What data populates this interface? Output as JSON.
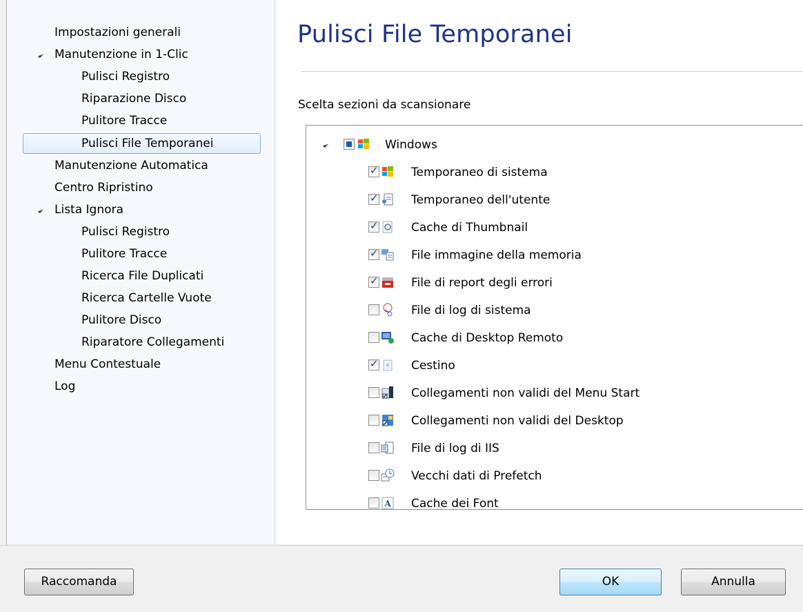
{
  "sidebar": {
    "items": [
      {
        "label": "Impostazioni generali"
      },
      {
        "label": "Manutenzione in 1-Clic"
      },
      {
        "label": "Pulisci Registro"
      },
      {
        "label": "Riparazione Disco"
      },
      {
        "label": "Pulitore Tracce"
      },
      {
        "label": "Pulisci File Temporanei"
      },
      {
        "label": "Manutenzione Automatica"
      },
      {
        "label": "Centro Ripristino"
      },
      {
        "label": "Lista Ignora"
      },
      {
        "label": "Pulisci Registro"
      },
      {
        "label": "Pulitore Tracce"
      },
      {
        "label": "Ricerca File Duplicati"
      },
      {
        "label": "Ricerca Cartelle Vuote"
      },
      {
        "label": "Pulitore Disco"
      },
      {
        "label": "Riparatore Collegamenti"
      },
      {
        "label": "Menu Contestuale"
      },
      {
        "label": "Log"
      }
    ]
  },
  "main": {
    "title": "Pulisci File Temporanei",
    "section_label": "Scelta sezioni da scansionare",
    "tree": {
      "root": {
        "label": "Windows",
        "state": "partial",
        "icon": "windows-logo-icon"
      },
      "children": [
        {
          "label": "Temporaneo di sistema",
          "checked": true,
          "icon": "windows-logo-icon"
        },
        {
          "label": "Temporaneo dell'utente",
          "checked": true,
          "icon": "user-document-icon"
        },
        {
          "label": "Cache di Thumbnail",
          "checked": true,
          "icon": "thumbnail-icon"
        },
        {
          "label": "File immagine della memoria",
          "checked": true,
          "icon": "memory-dump-icon"
        },
        {
          "label": "File di report degli errori",
          "checked": true,
          "icon": "error-report-icon"
        },
        {
          "label": "File di log di sistema",
          "checked": false,
          "icon": "log-scissors-icon"
        },
        {
          "label": "Cache di Desktop Remoto",
          "checked": false,
          "icon": "remote-desktop-icon"
        },
        {
          "label": "Cestino",
          "checked": true,
          "icon": "recycle-bin-icon"
        },
        {
          "label": "Collegamenti non validi del Menu Start",
          "checked": false,
          "icon": "start-menu-shortcut-icon"
        },
        {
          "label": "Collegamenti non validi del Desktop",
          "checked": false,
          "icon": "desktop-shortcut-icon"
        },
        {
          "label": "File di log di IIS",
          "checked": false,
          "icon": "iis-log-icon"
        },
        {
          "label": "Vecchi dati di Prefetch",
          "checked": false,
          "icon": "prefetch-clock-icon"
        },
        {
          "label": "Cache dei Font",
          "checked": false,
          "icon": "font-icon"
        }
      ]
    }
  },
  "footer": {
    "recommend_label": "Raccomanda",
    "ok_label": "OK",
    "cancel_label": "Annulla"
  },
  "colors": {
    "title": "#1e3287",
    "sidebar_bg": "#f6f8fc",
    "selection_border": "#84acdd",
    "check": "#2b3f7a"
  }
}
